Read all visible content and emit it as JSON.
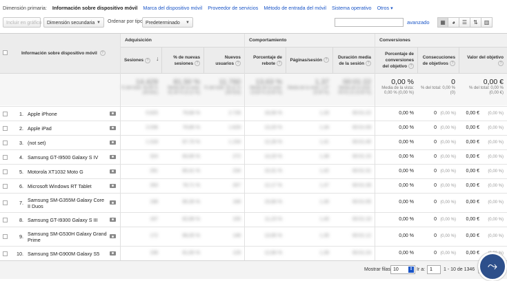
{
  "nav": {
    "primary_label": "Dimensión primaria:",
    "active": "Información sobre dispositivo móvil",
    "links": [
      "Marca del dispositivo móvil",
      "Proveedor de servicios",
      "Método de entrada del móvil",
      "Sistema operativo",
      "Otros"
    ]
  },
  "toolbar": {
    "chart_btn": "Incluir en gráfico",
    "secondary_dim": "Dimensión secundaria",
    "order_label": "Ordenar por tipo:",
    "order_value": "Predeterminado",
    "search_value": "",
    "advanced": "avanzado",
    "view_icons": [
      "grid-icon",
      "pie-icon",
      "bars-icon",
      "compare-icon",
      "pivot-icon"
    ]
  },
  "table": {
    "groups": [
      "Adquisición",
      "Comportamiento",
      "Conversiones"
    ],
    "headers": {
      "dim": "Información sobre dispositivo móvil",
      "sessions": "Sesiones",
      "pct_new": "% de nuevas sesiones",
      "new_users": "Nuevos usuarios",
      "bounce": "Porcentaje de rebote",
      "pages": "Páginas/sesión",
      "duration": "Duración media de la sesión",
      "conv_rate": "Porcentaje de conversiones del objetivo",
      "goal_comp": "Consecuciones de objetivos",
      "goal_value": "Valor del objetivo"
    },
    "totals": {
      "sessions": "14.429",
      "sessions_sub": "% del total: 33,06 % (43.641)",
      "pct_new": "81,50 %",
      "pct_new_sub": "Media de la vista: 81,40 % (0,12 %)",
      "new_users": "11.760",
      "new_users_sub": "% del total: 33,11 % (35.523)",
      "bounce": "13,63 %",
      "bounce_sub": "Media de la vista: 13,63 % (0,00 %)",
      "pages": "1,37",
      "pages_sub": "Media de la vista: 1,37 (0,00 %)",
      "duration": "00:01:22",
      "duration_sub": "Media de la vista: 00:01:22 (0,00 %)",
      "conv_rate": "0,00 %",
      "conv_rate_sub": "Media de la vista: 0,00 % (0,00 %)",
      "goal_comp": "0",
      "goal_comp_sub": "% del total: 0,00 % (0)",
      "goal_value": "0,00 €",
      "goal_value_sub": "% del total: 0,00 % (0,00 €)"
    },
    "rows": [
      {
        "idx": "1.",
        "device": "Apple iPhone",
        "sessions": "5.825",
        "pct_new": "79,68 %",
        "new_users": "2.726",
        "bounce": "16,06 %",
        "pages": "1,33",
        "duration": "00:01:22",
        "conv": "0,00 %",
        "goal": "0",
        "goal_pct": "(0,00 %)",
        "value": "0,00 €",
        "value_pct": "(0,00 %)"
      },
      {
        "idx": "2.",
        "device": "Apple iPad",
        "sessions": "2.036",
        "pct_new": "79,86 %",
        "new_users": "1.629",
        "bounce": "13,20 %",
        "pages": "1,34",
        "duration": "00:01:09",
        "conv": "0,00 %",
        "goal": "0",
        "goal_pct": "(0,00 %)",
        "value": "0,00 €",
        "value_pct": "(0,00 %)"
      },
      {
        "idx": "3.",
        "device": "(not set)",
        "sessions": "1.318",
        "pct_new": "87,70 %",
        "new_users": "1.154",
        "bounce": "12,26 %",
        "pages": "1,41",
        "duration": "00:01:40",
        "conv": "0,00 %",
        "goal": "0",
        "goal_pct": "(0,00 %)",
        "value": "0,00 €",
        "value_pct": "(0,00 %)"
      },
      {
        "idx": "4.",
        "device": "Samsung GT-I9500 Galaxy S IV",
        "sessions": "324",
        "pct_new": "83,95 %",
        "new_users": "272",
        "bounce": "14,20 %",
        "pages": "1,38",
        "duration": "00:01:15",
        "conv": "0,00 %",
        "goal": "0",
        "goal_pct": "(0,00 %)",
        "value": "0,00 €",
        "value_pct": "(0,00 %)"
      },
      {
        "idx": "5.",
        "device": "Motorola XT1032 Moto G",
        "sessions": "291",
        "pct_new": "80,41 %",
        "new_users": "234",
        "bounce": "10,31 %",
        "pages": "1,42",
        "duration": "00:01:31",
        "conv": "0,00 %",
        "goal": "0",
        "goal_pct": "(0,00 %)",
        "value": "0,00 €",
        "value_pct": "(0,00 %)"
      },
      {
        "idx": "6.",
        "device": "Microsoft Windows RT Tablet",
        "sessions": "263",
        "pct_new": "78,71 %",
        "new_users": "207",
        "bounce": "12,17 %",
        "pages": "1,37",
        "duration": "00:01:28",
        "conv": "0,00 %",
        "goal": "0",
        "goal_pct": "(0,00 %)",
        "value": "0,00 €",
        "value_pct": "(0,00 %)"
      },
      {
        "idx": "7.",
        "device": "Samsung SM-G355M Galaxy Core II Duos",
        "sessions": "198",
        "pct_new": "85,35 %",
        "new_users": "169",
        "bounce": "15,66 %",
        "pages": "1,30",
        "duration": "00:01:05",
        "conv": "0,00 %",
        "goal": "0",
        "goal_pct": "(0,00 %)",
        "value": "0,00 €",
        "value_pct": "(0,00 %)"
      },
      {
        "idx": "8.",
        "device": "Samsung GT-I9300 Galaxy S III",
        "sessions": "187",
        "pct_new": "82,89 %",
        "new_users": "155",
        "bounce": "11,23 %",
        "pages": "1,40",
        "duration": "00:01:19",
        "conv": "0,00 %",
        "goal": "0",
        "goal_pct": "(0,00 %)",
        "value": "0,00 €",
        "value_pct": "(0,00 %)"
      },
      {
        "idx": "9.",
        "device": "Samsung SM-G530H Galaxy Grand Prime",
        "sessions": "172",
        "pct_new": "86,05 %",
        "new_users": "148",
        "bounce": "13,95 %",
        "pages": "1,35",
        "duration": "00:01:12",
        "conv": "0,00 %",
        "goal": "0",
        "goal_pct": "(0,00 %)",
        "value": "0,00 €",
        "value_pct": "(0,00 %)"
      },
      {
        "idx": "10.",
        "device": "Samsung SM-G900M Galaxy S5",
        "sessions": "158",
        "pct_new": "81,65 %",
        "new_users": "129",
        "bounce": "12,66 %",
        "pages": "1,39",
        "duration": "00:01:24",
        "conv": "0,00 %",
        "goal": "0",
        "goal_pct": "(0,00 %)",
        "value": "0,00 €",
        "value_pct": "(0,00 %)"
      }
    ]
  },
  "footer": {
    "rows_label": "Mostrar filas:",
    "rows_value": "10",
    "goto_label": "Ir a:",
    "goto_value": "1",
    "range": "1 - 10 de 1346"
  }
}
